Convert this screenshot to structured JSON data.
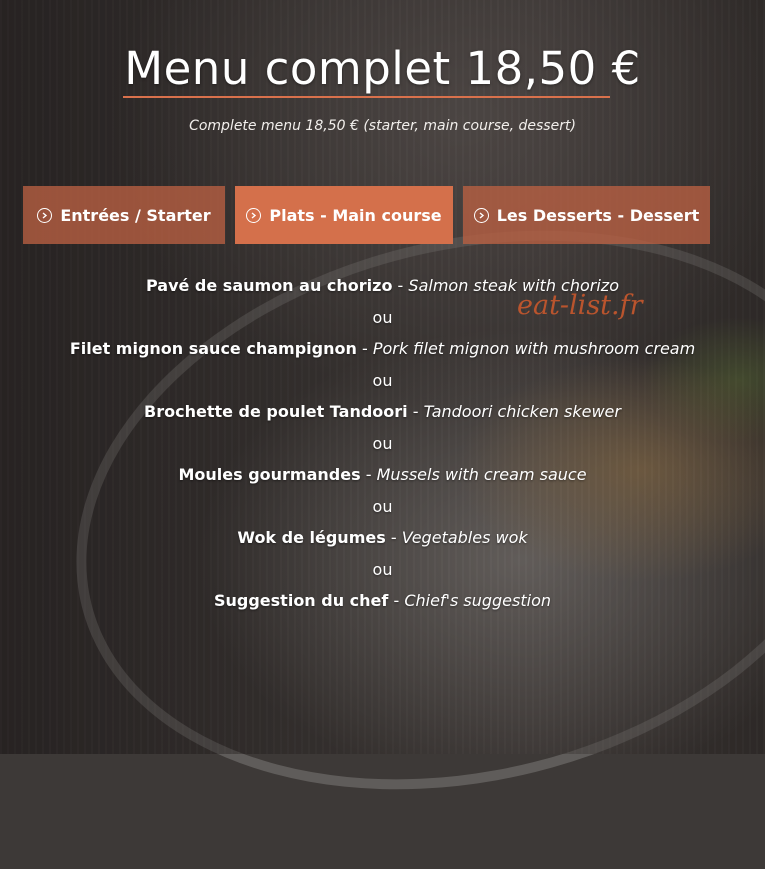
{
  "header": {
    "title": "Menu complet 18,50 €",
    "subtitle": "Complete menu 18,50 € (starter, main course, dessert)"
  },
  "tabs": [
    {
      "label": "Entrées / Starter",
      "active": false
    },
    {
      "label": "Plats - Main course",
      "active": true
    },
    {
      "label": "Les Desserts - Dessert",
      "active": false
    }
  ],
  "dishes": [
    {
      "fr": "Pavé de saumon au chorizo",
      "sep": " - ",
      "en": "Salmon steak with chorizo"
    },
    {
      "fr": "Filet mignon sauce champignon",
      "sep": " - ",
      "en": "Pork filet mignon with mushroom cream"
    },
    {
      "fr": "Brochette de poulet Tandoori",
      "sep": " - ",
      "en": "Tandoori chicken skewer"
    },
    {
      "fr": "Moules gourmandes",
      "sep": " - ",
      "en": "Mussels with cream sauce"
    },
    {
      "fr": "Wok de légumes",
      "sep": " - ",
      "en": "Vegetables wok"
    },
    {
      "fr": "Suggestion du chef",
      "sep": " - ",
      "en": "Chief's suggestion"
    }
  ],
  "separator": "ou",
  "watermark": "eat-list.fr",
  "colors": {
    "accent": "#d4704b",
    "tab": "#ba6042"
  }
}
